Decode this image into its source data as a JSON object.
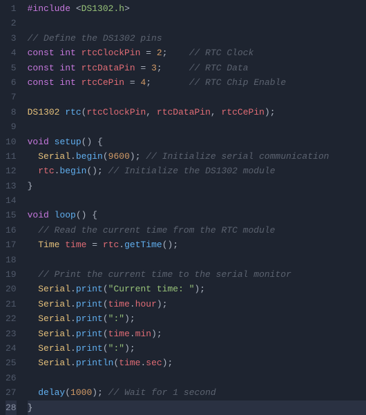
{
  "lines": [
    {
      "n": 1,
      "tokens": [
        [
          "preproc",
          "#include"
        ],
        [
          "punct",
          " <"
        ],
        [
          "include-path",
          "DS1302.h"
        ],
        [
          "punct",
          ">"
        ]
      ]
    },
    {
      "n": 2,
      "tokens": []
    },
    {
      "n": 3,
      "tokens": [
        [
          "comment",
          "// Define the DS1302 pins"
        ]
      ]
    },
    {
      "n": 4,
      "tokens": [
        [
          "type",
          "const int"
        ],
        [
          "ident",
          " "
        ],
        [
          "var",
          "rtcClockPin"
        ],
        [
          "ident",
          " "
        ],
        [
          "op",
          "="
        ],
        [
          "ident",
          " "
        ],
        [
          "num",
          "2"
        ],
        [
          "punct",
          ";"
        ],
        [
          "ident",
          "    "
        ],
        [
          "comment",
          "// RTC Clock"
        ]
      ]
    },
    {
      "n": 5,
      "tokens": [
        [
          "type",
          "const int"
        ],
        [
          "ident",
          " "
        ],
        [
          "var",
          "rtcDataPin"
        ],
        [
          "ident",
          " "
        ],
        [
          "op",
          "="
        ],
        [
          "ident",
          " "
        ],
        [
          "num",
          "3"
        ],
        [
          "punct",
          ";"
        ],
        [
          "ident",
          "     "
        ],
        [
          "comment",
          "// RTC Data"
        ]
      ]
    },
    {
      "n": 6,
      "tokens": [
        [
          "type",
          "const int"
        ],
        [
          "ident",
          " "
        ],
        [
          "var",
          "rtcCePin"
        ],
        [
          "ident",
          " "
        ],
        [
          "op",
          "="
        ],
        [
          "ident",
          " "
        ],
        [
          "num",
          "4"
        ],
        [
          "punct",
          ";"
        ],
        [
          "ident",
          "       "
        ],
        [
          "comment",
          "// RTC Chip Enable"
        ]
      ]
    },
    {
      "n": 7,
      "tokens": []
    },
    {
      "n": 8,
      "tokens": [
        [
          "classname",
          "DS1302"
        ],
        [
          "ident",
          " "
        ],
        [
          "func",
          "rtc"
        ],
        [
          "punct",
          "("
        ],
        [
          "var",
          "rtcClockPin"
        ],
        [
          "punct",
          ", "
        ],
        [
          "var",
          "rtcDataPin"
        ],
        [
          "punct",
          ", "
        ],
        [
          "var",
          "rtcCePin"
        ],
        [
          "punct",
          ");"
        ]
      ]
    },
    {
      "n": 9,
      "tokens": []
    },
    {
      "n": 10,
      "tokens": [
        [
          "type",
          "void"
        ],
        [
          "ident",
          " "
        ],
        [
          "func",
          "setup"
        ],
        [
          "punct",
          "() {"
        ]
      ]
    },
    {
      "n": 11,
      "tokens": [
        [
          "ident",
          "  "
        ],
        [
          "obj",
          "Serial"
        ],
        [
          "punct",
          "."
        ],
        [
          "func",
          "begin"
        ],
        [
          "punct",
          "("
        ],
        [
          "num",
          "9600"
        ],
        [
          "punct",
          "); "
        ],
        [
          "comment",
          "// Initialize serial communication"
        ]
      ]
    },
    {
      "n": 12,
      "tokens": [
        [
          "ident",
          "  "
        ],
        [
          "var",
          "rtc"
        ],
        [
          "punct",
          "."
        ],
        [
          "func",
          "begin"
        ],
        [
          "punct",
          "(); "
        ],
        [
          "comment",
          "// Initialize the DS1302 module"
        ]
      ]
    },
    {
      "n": 13,
      "tokens": [
        [
          "punct",
          "}"
        ]
      ]
    },
    {
      "n": 14,
      "tokens": []
    },
    {
      "n": 15,
      "tokens": [
        [
          "type",
          "void"
        ],
        [
          "ident",
          " "
        ],
        [
          "func",
          "loop"
        ],
        [
          "punct",
          "() {"
        ]
      ]
    },
    {
      "n": 16,
      "tokens": [
        [
          "ident",
          "  "
        ],
        [
          "comment",
          "// Read the current time from the RTC module"
        ]
      ]
    },
    {
      "n": 17,
      "tokens": [
        [
          "ident",
          "  "
        ],
        [
          "classname",
          "Time"
        ],
        [
          "ident",
          " "
        ],
        [
          "var",
          "time"
        ],
        [
          "ident",
          " "
        ],
        [
          "op",
          "="
        ],
        [
          "ident",
          " "
        ],
        [
          "var",
          "rtc"
        ],
        [
          "punct",
          "."
        ],
        [
          "func",
          "getTime"
        ],
        [
          "punct",
          "();"
        ]
      ]
    },
    {
      "n": 18,
      "tokens": []
    },
    {
      "n": 19,
      "tokens": [
        [
          "ident",
          "  "
        ],
        [
          "comment",
          "// Print the current time to the serial monitor"
        ]
      ]
    },
    {
      "n": 20,
      "tokens": [
        [
          "ident",
          "  "
        ],
        [
          "obj",
          "Serial"
        ],
        [
          "punct",
          "."
        ],
        [
          "func",
          "print"
        ],
        [
          "punct",
          "("
        ],
        [
          "str",
          "\"Current time: \""
        ],
        [
          "punct",
          ");"
        ]
      ]
    },
    {
      "n": 21,
      "tokens": [
        [
          "ident",
          "  "
        ],
        [
          "obj",
          "Serial"
        ],
        [
          "punct",
          "."
        ],
        [
          "func",
          "print"
        ],
        [
          "punct",
          "("
        ],
        [
          "var",
          "time"
        ],
        [
          "punct",
          "."
        ],
        [
          "var",
          "hour"
        ],
        [
          "punct",
          ");"
        ]
      ]
    },
    {
      "n": 22,
      "tokens": [
        [
          "ident",
          "  "
        ],
        [
          "obj",
          "Serial"
        ],
        [
          "punct",
          "."
        ],
        [
          "func",
          "print"
        ],
        [
          "punct",
          "("
        ],
        [
          "str",
          "\":\""
        ],
        [
          "punct",
          ");"
        ]
      ]
    },
    {
      "n": 23,
      "tokens": [
        [
          "ident",
          "  "
        ],
        [
          "obj",
          "Serial"
        ],
        [
          "punct",
          "."
        ],
        [
          "func",
          "print"
        ],
        [
          "punct",
          "("
        ],
        [
          "var",
          "time"
        ],
        [
          "punct",
          "."
        ],
        [
          "var",
          "min"
        ],
        [
          "punct",
          ");"
        ]
      ]
    },
    {
      "n": 24,
      "tokens": [
        [
          "ident",
          "  "
        ],
        [
          "obj",
          "Serial"
        ],
        [
          "punct",
          "."
        ],
        [
          "func",
          "print"
        ],
        [
          "punct",
          "("
        ],
        [
          "str",
          "\":\""
        ],
        [
          "punct",
          ");"
        ]
      ]
    },
    {
      "n": 25,
      "tokens": [
        [
          "ident",
          "  "
        ],
        [
          "obj",
          "Serial"
        ],
        [
          "punct",
          "."
        ],
        [
          "func",
          "println"
        ],
        [
          "punct",
          "("
        ],
        [
          "var",
          "time"
        ],
        [
          "punct",
          "."
        ],
        [
          "var",
          "sec"
        ],
        [
          "punct",
          ");"
        ]
      ]
    },
    {
      "n": 26,
      "tokens": []
    },
    {
      "n": 27,
      "tokens": [
        [
          "ident",
          "  "
        ],
        [
          "func",
          "delay"
        ],
        [
          "punct",
          "("
        ],
        [
          "num",
          "1000"
        ],
        [
          "punct",
          "); "
        ],
        [
          "comment",
          "// Wait for 1 second"
        ]
      ]
    },
    {
      "n": 28,
      "tokens": [
        [
          "punct",
          "}"
        ]
      ],
      "active": true
    }
  ]
}
